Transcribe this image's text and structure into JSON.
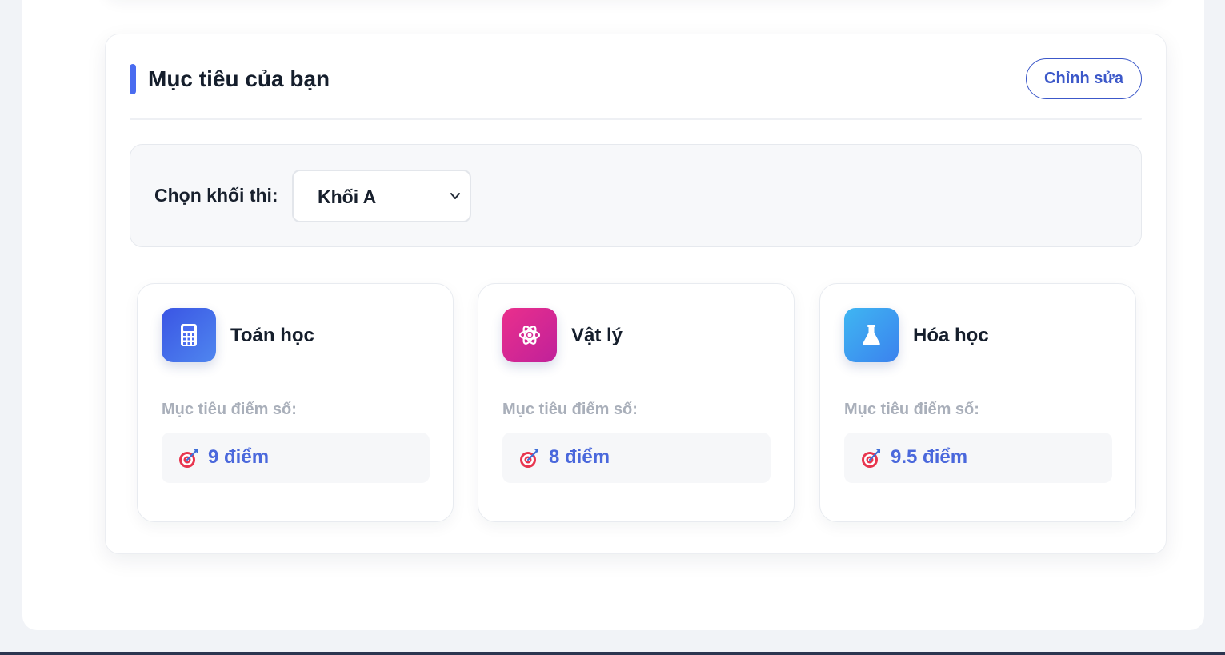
{
  "goals": {
    "title": "Mục tiêu của bạn",
    "edit_label": "Chỉnh sửa",
    "block_selector": {
      "label": "Chọn khối thi:",
      "selected": "Khối A"
    },
    "subjects": [
      {
        "name": "Toán học",
        "icon": "calculator-icon",
        "target_label": "Mục tiêu điểm số:",
        "target_value": "9 điểm"
      },
      {
        "name": "Vật lý",
        "icon": "atom-icon",
        "target_label": "Mục tiêu điểm số:",
        "target_value": "8 điểm"
      },
      {
        "name": "Hóa học",
        "icon": "flask-icon",
        "target_label": "Mục tiêu điểm số:",
        "target_value": "9.5 điểm"
      }
    ]
  },
  "colors": {
    "accent": "#4a6cf0",
    "edit_button": "#3c58c9",
    "target_text": "#4a68dc",
    "math_icon": "#3f63e6",
    "physics_icon": "#e0248f",
    "chemistry_icon": "#3ea2f2"
  }
}
